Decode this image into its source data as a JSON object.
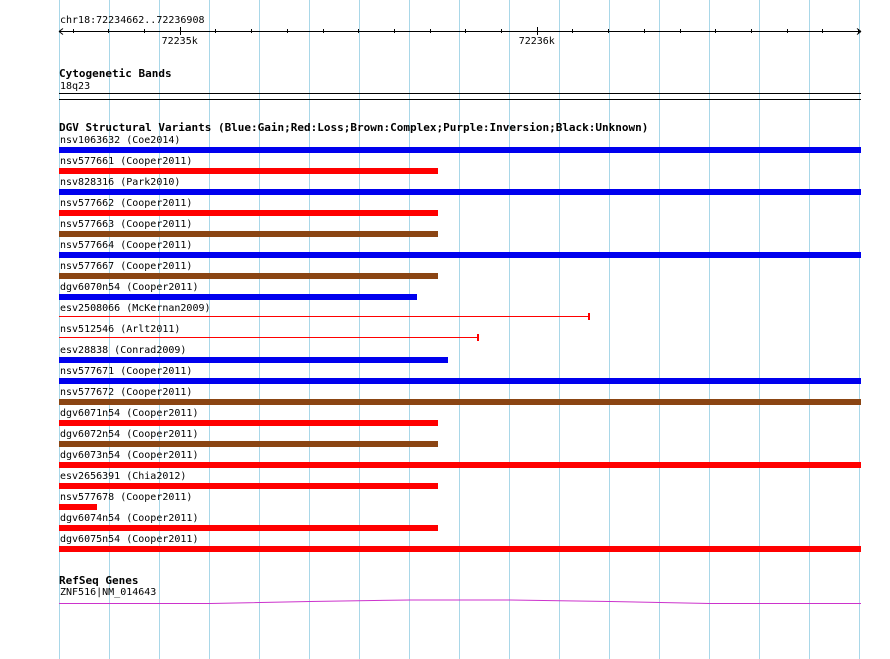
{
  "location": "chr18:72234662..72236908",
  "ruler": {
    "start": 72234662,
    "end": 72236908,
    "ticks": [
      {
        "pos": 72235000,
        "label": "72235k"
      },
      {
        "pos": 72236000,
        "label": "72236k"
      }
    ]
  },
  "cytobands": {
    "title": "Cytogenetic Bands",
    "band": "18q23"
  },
  "dgv": {
    "title": "DGV Structural Variants (Blue:Gain;Red:Loss;Brown:Complex;Purple:Inversion;Black:Unknown)",
    "colors": {
      "gain": "#0000ee",
      "loss": "#ff0000",
      "complex": "#8b4513"
    },
    "variants": [
      {
        "label": "nsv1063632 (Coe2014)",
        "type": "gain",
        "start": 0.0,
        "end": 1.0,
        "style": "thick"
      },
      {
        "label": "nsv577661 (Cooper2011)",
        "type": "loss",
        "start": 0.0,
        "end": 0.473,
        "style": "thick"
      },
      {
        "label": "nsv828316 (Park2010)",
        "type": "gain",
        "start": 0.0,
        "end": 1.0,
        "style": "thick"
      },
      {
        "label": "nsv577662 (Cooper2011)",
        "type": "loss",
        "start": 0.0,
        "end": 0.473,
        "style": "thick"
      },
      {
        "label": "nsv577663 (Cooper2011)",
        "type": "complex",
        "start": 0.0,
        "end": 0.473,
        "style": "thick"
      },
      {
        "label": "nsv577664 (Cooper2011)",
        "type": "gain",
        "start": 0.0,
        "end": 1.0,
        "style": "thick"
      },
      {
        "label": "nsv577667 (Cooper2011)",
        "type": "complex",
        "start": 0.0,
        "end": 0.473,
        "style": "thick"
      },
      {
        "label": "dgv6070n54 (Cooper2011)",
        "type": "gain",
        "start": 0.0,
        "end": 0.446,
        "style": "thick"
      },
      {
        "label": "esv2508066 (McKernan2009)",
        "type": "loss",
        "start": 0.0,
        "end": 0.661,
        "style": "thin"
      },
      {
        "label": "nsv512546 (Arlt2011)",
        "type": "loss",
        "start": 0.0,
        "end": 0.522,
        "style": "thin"
      },
      {
        "label": "esv28838 (Conrad2009)",
        "type": "gain",
        "start": 0.0,
        "end": 0.485,
        "style": "thick"
      },
      {
        "label": "nsv577671 (Cooper2011)",
        "type": "gain",
        "start": 0.0,
        "end": 1.0,
        "style": "thick"
      },
      {
        "label": "nsv577672 (Cooper2011)",
        "type": "complex",
        "start": 0.0,
        "end": 1.0,
        "style": "thick"
      },
      {
        "label": "dgv6071n54 (Cooper2011)",
        "type": "loss",
        "start": 0.0,
        "end": 0.473,
        "style": "thick"
      },
      {
        "label": "dgv6072n54 (Cooper2011)",
        "type": "complex",
        "start": 0.0,
        "end": 0.473,
        "style": "thick"
      },
      {
        "label": "dgv6073n54 (Cooper2011)",
        "type": "loss",
        "start": 0.0,
        "end": 1.0,
        "style": "thick"
      },
      {
        "label": "esv2656391 (Chia2012)",
        "type": "loss",
        "start": 0.0,
        "end": 0.473,
        "style": "thick"
      },
      {
        "label": "nsv577678 (Cooper2011)",
        "type": "loss",
        "start": 0.0,
        "end": 0.048,
        "style": "thick"
      },
      {
        "label": "dgv6074n54 (Cooper2011)",
        "type": "loss",
        "start": 0.0,
        "end": 0.473,
        "style": "thick"
      },
      {
        "label": "dgv6075n54 (Cooper2011)",
        "type": "loss",
        "start": 0.0,
        "end": 1.0,
        "style": "thick"
      }
    ]
  },
  "refseq": {
    "title": "RefSeq Genes",
    "gene": "ZNF516|NM_014643",
    "color": "#cc33cc"
  }
}
